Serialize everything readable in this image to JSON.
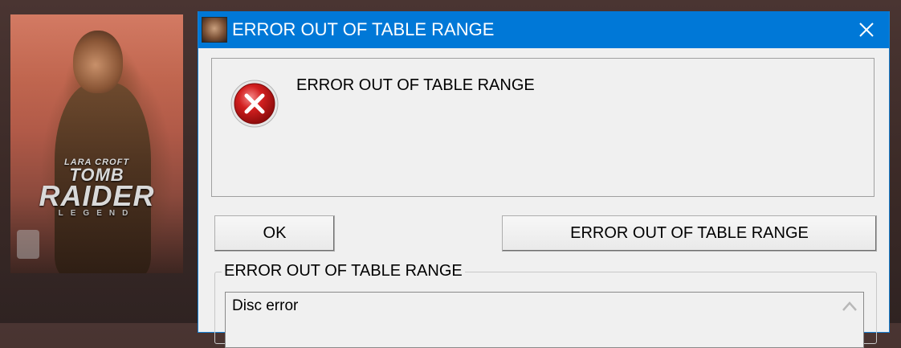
{
  "cover": {
    "logo_line1": "LARA CROFT",
    "logo_line2": "TOMB",
    "logo_line3": "RAIDER",
    "logo_line4": "LEGEND"
  },
  "dialog": {
    "title": "ERROR OUT OF TABLE RANGE",
    "app_icon": "game-icon",
    "close_icon": "close-icon",
    "error_icon": "error-icon",
    "message": "ERROR OUT OF TABLE RANGE",
    "ok_label": "OK",
    "details_button_label": "ERROR OUT OF TABLE RANGE",
    "group_label": "ERROR OUT OF TABLE RANGE",
    "details_text": "Disc error",
    "scroll_icon": "chevron-up-icon"
  },
  "colors": {
    "titlebar": "#0078d7",
    "error_red": "#d21f1f",
    "dialog_bg": "#f0f0f0"
  }
}
